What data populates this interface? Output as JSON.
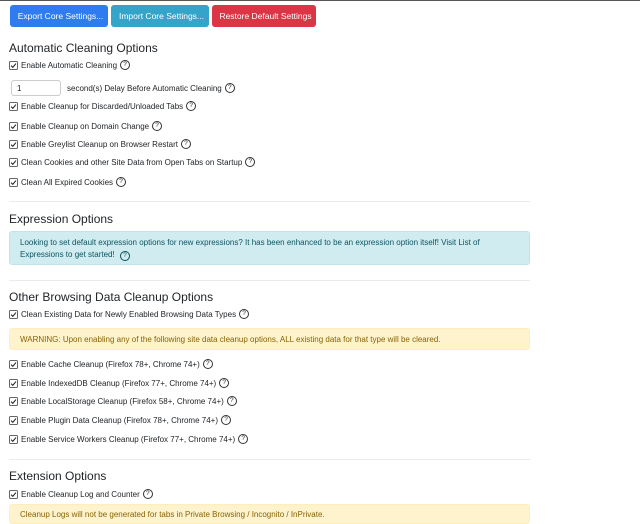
{
  "toolbar": {
    "export_label": "Export Core Settings...",
    "import_label": "Import Core Settings...",
    "restore_label": "Restore Default Settings",
    "colors": {
      "export": "#2f7bf0",
      "import": "#34a5c8",
      "restore": "#dc3545"
    }
  },
  "auto": {
    "title": "Automatic Cleaning Options",
    "enable_label": "Enable Automatic Cleaning",
    "delay_value": "1",
    "delay_label": "second(s) Delay Before Automatic Cleaning",
    "discarded_label": "Enable Cleanup for Discarded/Unloaded Tabs",
    "domain_change_label": "Enable Cleanup on Domain Change",
    "greylist_label": "Enable Greylist Cleanup on Browser Restart",
    "startup_label": "Clean Cookies and other Site Data from Open Tabs on Startup",
    "expired_label": "Clean All Expired Cookies"
  },
  "expression": {
    "title": "Expression Options",
    "info_text": "Looking to set default expression options for new expressions? It has been enhanced to be an expression option itself! Visit List of Expressions to get started!"
  },
  "browsing": {
    "title": "Other Browsing Data Cleanup Options",
    "clean_existing_label": "Clean Existing Data for Newly Enabled Browsing Data Types",
    "warning_text": "WARNING: Upon enabling any of the following site data cleanup options, ALL existing data for that type will be cleared.",
    "cache_label": "Enable Cache Cleanup (Firefox 78+, Chrome 74+)",
    "indexeddb_label": "Enable IndexedDB Cleanup (Firefox 77+, Chrome 74+)",
    "localstorage_label": "Enable LocalStorage Cleanup (Firefox 58+, Chrome 74+)",
    "plugin_label": "Enable Plugin Data Cleanup (Firefox 78+, Chrome 74+)",
    "serviceworkers_label": "Enable Service Workers Cleanup (Firefox 77+, Chrome 74+)"
  },
  "extension": {
    "title": "Extension Options",
    "log_label": "Enable Cleanup Log and Counter",
    "private_note": "Cleanup Logs will not be generated for tabs in Private Browsing / Incognito / InPrivate."
  },
  "icons": {
    "help_glyph": "?",
    "export": "download-icon",
    "import": "upload-icon",
    "restore": "undo-icon"
  }
}
